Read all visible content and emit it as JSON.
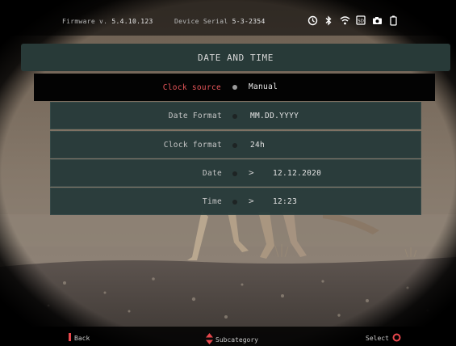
{
  "status_bar": {
    "firmware_label": "Firmware v.",
    "firmware_version": "5.4.10.123",
    "serial_label": "Device Serial",
    "serial_value": "5-3-2354",
    "icons": [
      "timer-icon",
      "bluetooth-icon",
      "wifi-icon",
      "sd-card-icon",
      "camera-icon",
      "battery-icon"
    ],
    "icon_color": "#ffffff",
    "battery_accent": "#ffffff"
  },
  "menu": {
    "title": "DATE AND TIME",
    "items": [
      {
        "label": "Clock source",
        "value": "Manual",
        "selected": true,
        "has_submenu": false
      },
      {
        "label": "Date Format",
        "value": "MM.DD.YYYY",
        "selected": false,
        "has_submenu": false
      },
      {
        "label": "Clock format",
        "value": "24h",
        "selected": false,
        "has_submenu": false
      },
      {
        "label": "Date",
        "value": "12.12.2020",
        "selected": false,
        "has_submenu": true
      },
      {
        "label": "Time",
        "value": "12:23",
        "selected": false,
        "has_submenu": true
      }
    ]
  },
  "hints": {
    "back": "Back",
    "subcategory": "Subcategory",
    "select": "Select"
  },
  "colors": {
    "accent_red": "#e8474c",
    "panel": "#283a38",
    "selected_row": "#030303"
  }
}
